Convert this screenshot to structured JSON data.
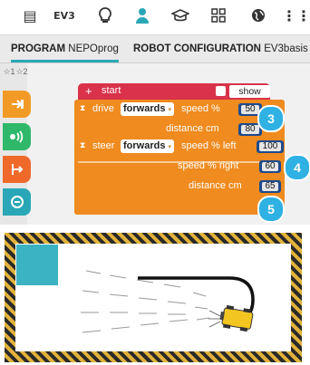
{
  "toolbar": {
    "icons": [
      {
        "name": "document-icon",
        "glyph": "▤"
      },
      {
        "name": "ev3-label",
        "glyph": "EV3"
      },
      {
        "name": "lightbulb-icon",
        "glyph": "💡"
      },
      {
        "name": "user-icon",
        "glyph": "👤"
      },
      {
        "name": "graduation-cap-icon",
        "glyph": "🎓"
      },
      {
        "name": "grid-icon",
        "glyph": "⊞"
      },
      {
        "name": "globe-icon",
        "glyph": "🌐"
      },
      {
        "name": "more-icon",
        "glyph": "⋮"
      }
    ]
  },
  "tabs": {
    "program_bold": "PROGRAM",
    "program_name": "NEPOprog",
    "robot_bold": "ROBOT CONFIGURATION",
    "robot_name": "EV3basis"
  },
  "sidebar": {
    "level1": "☆1",
    "level2": "☆2",
    "categories": [
      {
        "name": "action-category-icon",
        "glyph": "⊐",
        "color": "#f29a26"
      },
      {
        "name": "sensor-category-icon",
        "glyph": "◉",
        "color": "#2fb86a"
      },
      {
        "name": "control-category-icon",
        "glyph": "⇆",
        "color": "#ef6a2a"
      },
      {
        "name": "logic-category-icon",
        "glyph": "◌",
        "color": "#2aa7b6"
      }
    ]
  },
  "program": {
    "start_label": "start",
    "show_sensor_label": "show sensor data",
    "drive": {
      "label": "drive",
      "direction": "forwards",
      "speed_label": "speed %",
      "speed": "50",
      "distance_label": "distance cm",
      "distance": "80"
    },
    "steer": {
      "label": "steer",
      "direction": "forwards",
      "speed_left_label": "speed %  left",
      "speed_left": "100",
      "speed_right_label": "speed %  right",
      "speed_right": "60",
      "distance_label": "distance cm",
      "distance": "65"
    },
    "callouts": [
      "3",
      "4",
      "5"
    ]
  },
  "colors": {
    "accent": "#2aa7b6",
    "block_orange": "#ef8b1f",
    "start_red": "#d9324a",
    "input_blue": "#1e4a8c",
    "callout_blue": "#2fb1e3"
  }
}
